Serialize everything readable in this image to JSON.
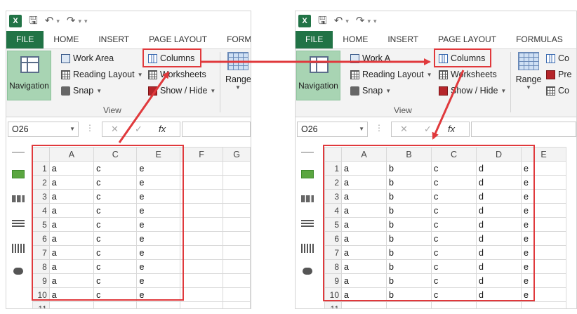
{
  "left_window": {
    "tabs": [
      "FILE",
      "HOME",
      "INSERT",
      "PAGE LAYOUT",
      "FORMUL"
    ],
    "ribbon": {
      "navigation": "Navigation",
      "work_area": "Work Area",
      "reading_layout": "Reading Layout",
      "snap": "Snap",
      "columns": "Columns",
      "worksheets": "Worksheets",
      "show_hide": "Show / Hide",
      "range": "Range",
      "group_label": "View"
    },
    "formula_bar": {
      "name_box": "O26",
      "fx": "fx"
    },
    "columns": [
      "A",
      "C",
      "E",
      "F",
      "G"
    ],
    "rows": [
      [
        "1",
        "a",
        "c",
        "e"
      ],
      [
        "2",
        "a",
        "c",
        "e"
      ],
      [
        "3",
        "a",
        "c",
        "e"
      ],
      [
        "4",
        "a",
        "c",
        "e"
      ],
      [
        "5",
        "a",
        "c",
        "e"
      ],
      [
        "6",
        "a",
        "c",
        "e"
      ],
      [
        "7",
        "a",
        "c",
        "e"
      ],
      [
        "8",
        "a",
        "c",
        "e"
      ],
      [
        "9",
        "a",
        "c",
        "e"
      ],
      [
        "10",
        "a",
        "c",
        "e"
      ],
      [
        "11",
        "",
        "",
        ""
      ]
    ]
  },
  "right_window": {
    "tabs": [
      "FILE",
      "HOME",
      "INSERT",
      "PAGE LAYOUT",
      "FORMULAS"
    ],
    "ribbon": {
      "navigation": "Navigation",
      "work_area": "Work A",
      "reading_layout": "Reading Layout",
      "snap": "Snap",
      "columns": "Columns",
      "worksheets": "Worksheets",
      "show_hide": "Show / Hide",
      "range": "Range",
      "group_label": "View",
      "co1": "Co",
      "pre": "Pre",
      "co2": "Co"
    },
    "formula_bar": {
      "name_box": "O26",
      "fx": "fx"
    },
    "columns": [
      "A",
      "B",
      "C",
      "D",
      "E"
    ],
    "rows": [
      [
        "1",
        "a",
        "b",
        "c",
        "d",
        "e"
      ],
      [
        "2",
        "a",
        "b",
        "c",
        "d",
        "e"
      ],
      [
        "3",
        "a",
        "b",
        "c",
        "d",
        "e"
      ],
      [
        "4",
        "a",
        "b",
        "c",
        "d",
        "e"
      ],
      [
        "5",
        "a",
        "b",
        "c",
        "d",
        "e"
      ],
      [
        "6",
        "a",
        "b",
        "c",
        "d",
        "e"
      ],
      [
        "7",
        "a",
        "b",
        "c",
        "d",
        "e"
      ],
      [
        "8",
        "a",
        "b",
        "c",
        "d",
        "e"
      ],
      [
        "9",
        "a",
        "b",
        "c",
        "d",
        "e"
      ],
      [
        "10",
        "a",
        "b",
        "c",
        "d",
        "e"
      ],
      [
        "11",
        "",
        "",
        "",
        "",
        ""
      ]
    ]
  },
  "colors": {
    "excel_green": "#217346",
    "highlight_red": "#e0393c",
    "nav_green": "#a8d4b3"
  },
  "icons": [
    "excel-logo-icon",
    "save-icon",
    "undo-icon",
    "redo-icon",
    "navigation-icon",
    "work-area-icon",
    "reading-layout-icon",
    "snap-icon",
    "columns-icon",
    "worksheets-icon",
    "show-hide-icon",
    "range-icon"
  ]
}
